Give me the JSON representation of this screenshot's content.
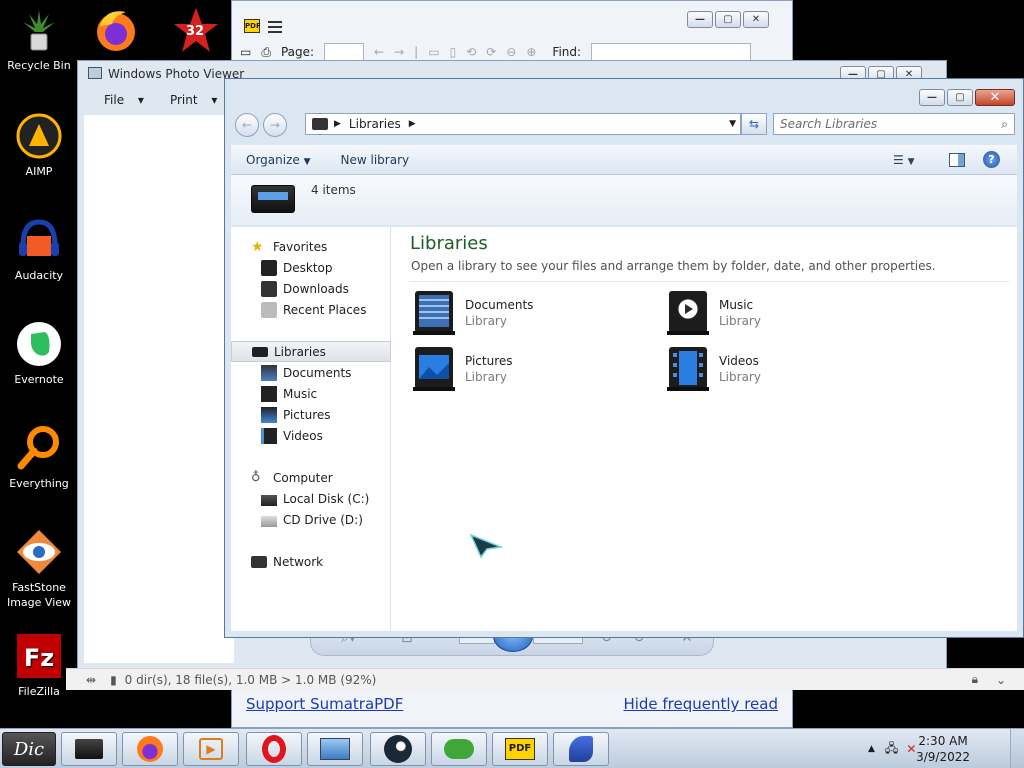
{
  "desktop": {
    "icons": [
      {
        "label": "Recycle Bin"
      },
      {
        "label": "AIMP"
      },
      {
        "label": "Audacity"
      },
      {
        "label": "Evernote"
      },
      {
        "label": "Everything"
      },
      {
        "label": "FastStone Image View"
      },
      {
        "label": "FileZilla"
      }
    ],
    "top_badge": "32"
  },
  "sumatra": {
    "page_label": "Page:",
    "find_label": "Find:",
    "link_left": "Support SumatraPDF",
    "link_right": "Hide frequently read"
  },
  "photo_viewer": {
    "title": "Windows Photo Viewer",
    "menu": [
      "File",
      "Print"
    ]
  },
  "explorer": {
    "address": "Libraries",
    "search_placeholder": "Search Libraries",
    "toolbar": {
      "organize": "Organize",
      "new_library": "New library"
    },
    "items_count": "4 items",
    "nav": {
      "favorites": "Favorites",
      "desktop": "Desktop",
      "downloads": "Downloads",
      "recent": "Recent Places",
      "libraries": "Libraries",
      "documents": "Documents",
      "music": "Music",
      "pictures": "Pictures",
      "videos": "Videos",
      "computer": "Computer",
      "local_disk": "Local Disk (C:)",
      "cd_drive": "CD Drive (D:)",
      "network": "Network"
    },
    "content": {
      "heading": "Libraries",
      "description": "Open a library to see your files and arrange them by folder, date, and other properties.",
      "libraries": [
        {
          "name": "Documents",
          "type": "Library"
        },
        {
          "name": "Music",
          "type": "Library"
        },
        {
          "name": "Pictures",
          "type": "Library"
        },
        {
          "name": "Videos",
          "type": "Library"
        }
      ]
    }
  },
  "statusbar": {
    "text": "0 dir(s), 18 file(s), 1.0 MB > 1.0 MB (92%)"
  },
  "taskbar": {
    "start_label": "Dic",
    "time": "2:30 AM",
    "date": "3/9/2022"
  },
  "colors": {
    "heading": "#1e5b2a",
    "accent": "#2a6cc4",
    "close": "#c4452a"
  }
}
